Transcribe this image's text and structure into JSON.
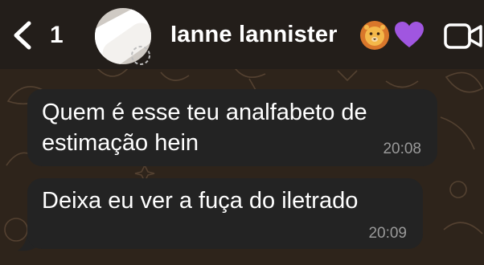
{
  "header": {
    "back_count": "1",
    "contact_name": "Ianne lannister",
    "name_emojis": [
      "lion-emoji",
      "purple-heart-emoji"
    ],
    "video_call": "video-camera-icon"
  },
  "messages": [
    {
      "text": "Quem é esse teu analfabeto de\nestimação hein",
      "time": "20:08"
    },
    {
      "text": "Deixa eu ver a fuça do iletrado",
      "time": "20:09"
    }
  ],
  "colors": {
    "header_bg": "#231e1a",
    "wallpaper": "#2e241b",
    "bubble": "#232323",
    "time_text": "#9a9a9a"
  }
}
